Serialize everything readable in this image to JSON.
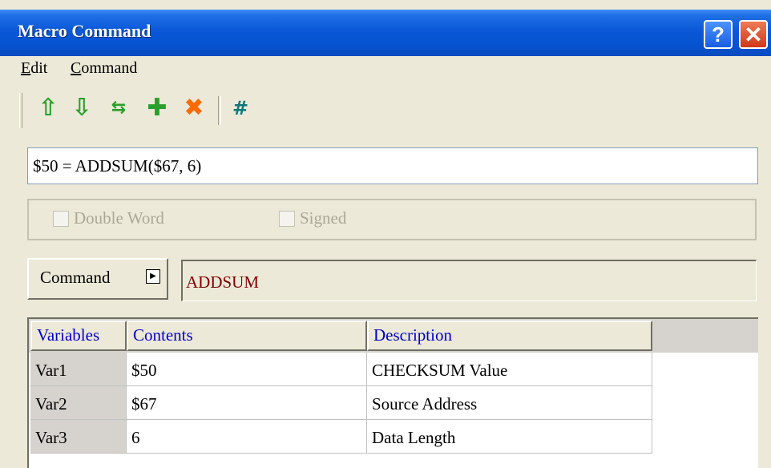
{
  "window": {
    "title": "Macro Command"
  },
  "menu": {
    "items": [
      "Edit",
      "Command"
    ]
  },
  "toolbar": {
    "buttons": [
      {
        "icon": "arrow-up-icon",
        "color": "#2aa02a"
      },
      {
        "icon": "arrow-down-icon",
        "color": "#2aa02a"
      },
      {
        "icon": "swap-icon",
        "color": "#2aa02a"
      },
      {
        "icon": "plus-icon",
        "color": "#2aa02a"
      },
      {
        "icon": "delete-x-icon",
        "color": "#ff6a00"
      },
      {
        "icon": "hash-icon",
        "color": "#0a7a7a"
      }
    ]
  },
  "expression": {
    "value": "$50 = ADDSUM($67, 6)"
  },
  "options": {
    "double_word": {
      "label": "Double Word",
      "checked": false,
      "enabled": false
    },
    "signed": {
      "label": "Signed",
      "checked": false,
      "enabled": false
    }
  },
  "command": {
    "button_label": "Command",
    "name": "ADDSUM",
    "name_color": "#800000"
  },
  "grid": {
    "headers": [
      "Variables",
      "Contents",
      "Description"
    ],
    "rows": [
      {
        "var": "Var1",
        "contents": "$50",
        "description": "CHECKSUM Value"
      },
      {
        "var": "Var2",
        "contents": "$67",
        "description": "Source Address"
      },
      {
        "var": "Var3",
        "contents": "6",
        "description": "Data Length"
      }
    ]
  }
}
